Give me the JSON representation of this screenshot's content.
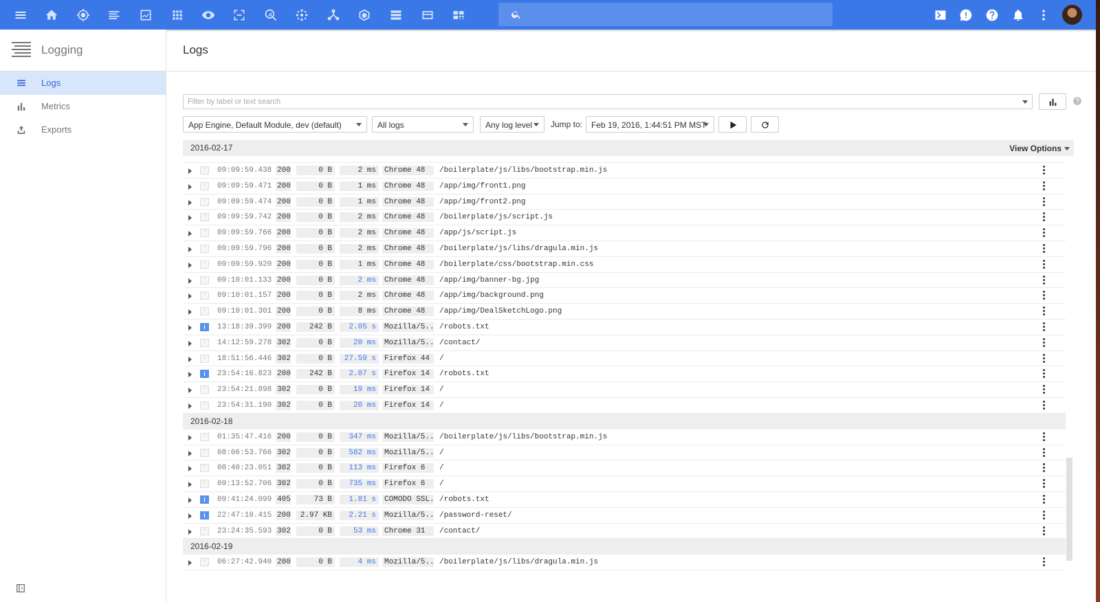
{
  "topbar": {
    "icons": [
      "menu-icon",
      "home-icon",
      "target-icon",
      "list-icon",
      "monitoring-icon",
      "apps-grid-icon",
      "eye-icon",
      "expand-icon",
      "search-chart-icon",
      "cluster-icon",
      "tree-icon",
      "hexagon-icon",
      "storage-icon",
      "card-icon",
      "qr-icon"
    ],
    "search_placeholder": "",
    "right_icons": [
      "cloud-shell-icon",
      "feedback-icon",
      "help-icon",
      "notifications-icon",
      "more-vert-icon"
    ]
  },
  "sidebar": {
    "title": "Logging",
    "items": [
      {
        "label": "Logs",
        "icon": "list-icon",
        "active": true
      },
      {
        "label": "Metrics",
        "icon": "bar-chart-icon",
        "active": false
      },
      {
        "label": "Exports",
        "icon": "export-icon",
        "active": false
      }
    ]
  },
  "main": {
    "title": "Logs",
    "filter_placeholder": "Filter by label or text search",
    "resource_select": "App Engine, Default Module, dev (default)",
    "logs_select": "All logs",
    "level_select": "Any log level",
    "jump_label": "Jump to:",
    "jump_date": "Feb 19, 2016, 1:44:51 PM MST",
    "view_options": "View Options"
  },
  "log_groups": [
    {
      "date": "2016-02-17",
      "rows": [
        {
          "time": "09:09:59.438",
          "status": "200",
          "size": "0 B",
          "latency": "2 ms",
          "agent": "Chrome 48",
          "path": "/boilerplate/js/libs/bootstrap.min.js",
          "info": false
        },
        {
          "time": "09:09:59.471",
          "status": "200",
          "size": "0 B",
          "latency": "1 ms",
          "agent": "Chrome 48",
          "path": "/app/img/front1.png",
          "info": false
        },
        {
          "time": "09:09:59.474",
          "status": "200",
          "size": "0 B",
          "latency": "1 ms",
          "agent": "Chrome 48",
          "path": "/app/img/front2.png",
          "info": false
        },
        {
          "time": "09:09:59.742",
          "status": "200",
          "size": "0 B",
          "latency": "2 ms",
          "agent": "Chrome 48",
          "path": "/boilerplate/js/script.js",
          "info": false
        },
        {
          "time": "09:09:59.766",
          "status": "200",
          "size": "0 B",
          "latency": "2 ms",
          "agent": "Chrome 48",
          "path": "/app/js/script.js",
          "info": false
        },
        {
          "time": "09:09:59.796",
          "status": "200",
          "size": "0 B",
          "latency": "2 ms",
          "agent": "Chrome 48",
          "path": "/boilerplate/js/libs/dragula.min.js",
          "info": false
        },
        {
          "time": "09:09:59.920",
          "status": "200",
          "size": "0 B",
          "latency": "1 ms",
          "agent": "Chrome 48",
          "path": "/boilerplate/css/bootstrap.min.css",
          "info": false
        },
        {
          "time": "09:10:01.133",
          "status": "200",
          "size": "0 B",
          "latency": "2 ms",
          "agent": "Chrome 48",
          "path": "/app/img/banner-bg.jpg",
          "info": false,
          "slow": true
        },
        {
          "time": "09:10:01.157",
          "status": "200",
          "size": "0 B",
          "latency": "2 ms",
          "agent": "Chrome 48",
          "path": "/app/img/background.png",
          "info": false
        },
        {
          "time": "09:10:01.301",
          "status": "200",
          "size": "0 B",
          "latency": "8 ms",
          "agent": "Chrome 48",
          "path": "/app/img/DealSketchLogo.png",
          "info": false
        },
        {
          "time": "13:18:39.399",
          "status": "200",
          "size": "242 B",
          "latency": "2.05 s",
          "agent": "Mozilla/5..",
          "path": "/robots.txt",
          "info": true,
          "slow": true
        },
        {
          "time": "14:12:59.278",
          "status": "302",
          "size": "0 B",
          "latency": "20 ms",
          "agent": "Mozilla/5..",
          "path": "/contact/",
          "info": false,
          "slow": true
        },
        {
          "time": "18:51:56.446",
          "status": "302",
          "size": "0 B",
          "latency": "27.59 s",
          "agent": "Firefox 44",
          "path": "/",
          "info": false,
          "slow": true
        },
        {
          "time": "23:54:16.823",
          "status": "200",
          "size": "242 B",
          "latency": "2.07 s",
          "agent": "Firefox 14",
          "path": "/robots.txt",
          "info": true,
          "slow": true
        },
        {
          "time": "23:54:21.898",
          "status": "302",
          "size": "0 B",
          "latency": "19 ms",
          "agent": "Firefox 14",
          "path": "/",
          "info": false,
          "slow": true
        },
        {
          "time": "23:54:31.190",
          "status": "302",
          "size": "0 B",
          "latency": "20 ms",
          "agent": "Firefox 14",
          "path": "/",
          "info": false,
          "slow": true
        }
      ]
    },
    {
      "date": "2016-02-18",
      "rows": [
        {
          "time": "01:35:47.416",
          "status": "200",
          "size": "0 B",
          "latency": "347 ms",
          "agent": "Mozilla/5..",
          "path": "/boilerplate/js/libs/bootstrap.min.js",
          "info": false,
          "slow": true
        },
        {
          "time": "08:06:53.766",
          "status": "302",
          "size": "0 B",
          "latency": "582 ms",
          "agent": "Mozilla/5..",
          "path": "/",
          "info": false,
          "slow": true
        },
        {
          "time": "08:40:23.051",
          "status": "302",
          "size": "0 B",
          "latency": "113 ms",
          "agent": "Firefox 6",
          "path": "/",
          "info": false,
          "slow": true
        },
        {
          "time": "09:13:52.706",
          "status": "302",
          "size": "0 B",
          "latency": "735 ms",
          "agent": "Firefox 6",
          "path": "/",
          "info": false,
          "slow": true
        },
        {
          "time": "09:41:24.099",
          "status": "405",
          "size": "73 B",
          "latency": "1.81 s",
          "agent": "COMODO SSL.",
          "path": "/robots.txt",
          "info": true,
          "slow": true
        },
        {
          "time": "22:47:10.415",
          "status": "200",
          "size": "2.97 KB",
          "latency": "2.21 s",
          "agent": "Mozilla/5..",
          "path": "/password-reset/",
          "info": true,
          "slow": true
        },
        {
          "time": "23:24:35.593",
          "status": "302",
          "size": "0 B",
          "latency": "53 ms",
          "agent": "Chrome 31",
          "path": "/contact/",
          "info": false,
          "slow": true
        }
      ]
    },
    {
      "date": "2016-02-19",
      "rows": [
        {
          "time": "06:27:42.940",
          "status": "200",
          "size": "0 B",
          "latency": "4 ms",
          "agent": "Mozilla/5..",
          "path": "/boilerplate/js/libs/dragula.min.js",
          "info": false,
          "slow": true
        }
      ]
    }
  ],
  "colors": {
    "topbar": "#3b78e7",
    "active_nav_bg": "#d8e6fb",
    "accent": "#3367d6",
    "info_badge": "#5a8fec"
  }
}
